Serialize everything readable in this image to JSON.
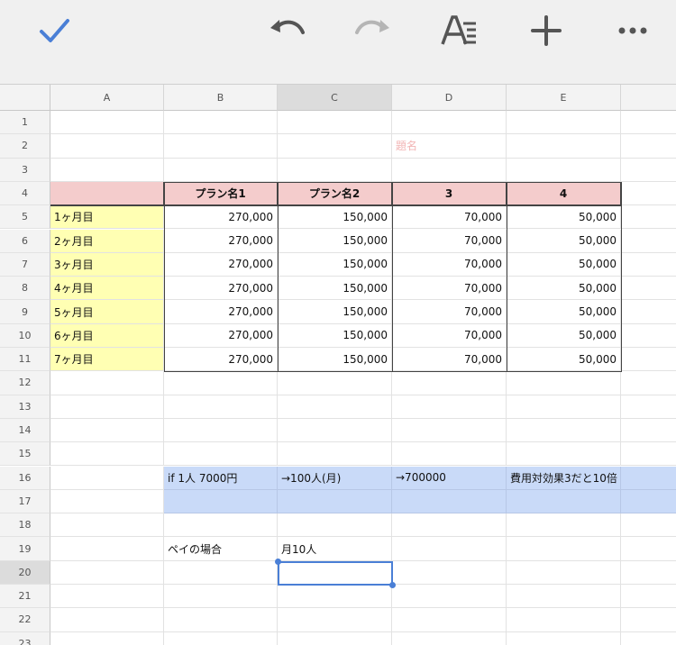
{
  "toolbar": {
    "done_icon": "checkmark-icon",
    "undo_icon": "undo-icon",
    "redo_icon": "redo-icon",
    "format_icon": "text-format-icon",
    "insert_icon": "plus-icon",
    "more_icon": "more-icon",
    "accent_color": "#4a7fd6"
  },
  "columns": [
    "A",
    "B",
    "C",
    "D",
    "E"
  ],
  "selected_column": "C",
  "rows": [
    "1",
    "2",
    "3",
    "4",
    "5",
    "6",
    "7",
    "8",
    "9",
    "10",
    "11",
    "12",
    "13",
    "14",
    "15",
    "16",
    "17",
    "18",
    "19",
    "20",
    "21",
    "22",
    "23"
  ],
  "selected_row": "20",
  "sheet_title": "題名",
  "table": {
    "headers": [
      "",
      "プラン名1",
      "プラン名2",
      "3",
      "4"
    ],
    "rows": [
      [
        "1ヶ月目",
        "270,000",
        "150,000",
        "70,000",
        "50,000"
      ],
      [
        "2ヶ月目",
        "270,000",
        "150,000",
        "70,000",
        "50,000"
      ],
      [
        "3ヶ月目",
        "270,000",
        "150,000",
        "70,000",
        "50,000"
      ],
      [
        "4ヶ月目",
        "270,000",
        "150,000",
        "70,000",
        "50,000"
      ],
      [
        "5ヶ月目",
        "270,000",
        "150,000",
        "70,000",
        "50,000"
      ],
      [
        "6ヶ月目",
        "270,000",
        "150,000",
        "70,000",
        "50,000"
      ],
      [
        "7ヶ月目",
        "270,000",
        "150,000",
        "70,000",
        "50,000"
      ]
    ]
  },
  "notes": {
    "b16": "if 1人 7000円",
    "c16": "→100人(月)",
    "d16": "→700000",
    "e16": "費用対効果3だと10倍",
    "b19": "ペイの場合",
    "c19": "月10人"
  },
  "colors": {
    "header_fill": "#f4cccc",
    "month_fill": "#ffffb3",
    "note_fill": "#c9daf8",
    "title_text": "#f2b4b4"
  }
}
